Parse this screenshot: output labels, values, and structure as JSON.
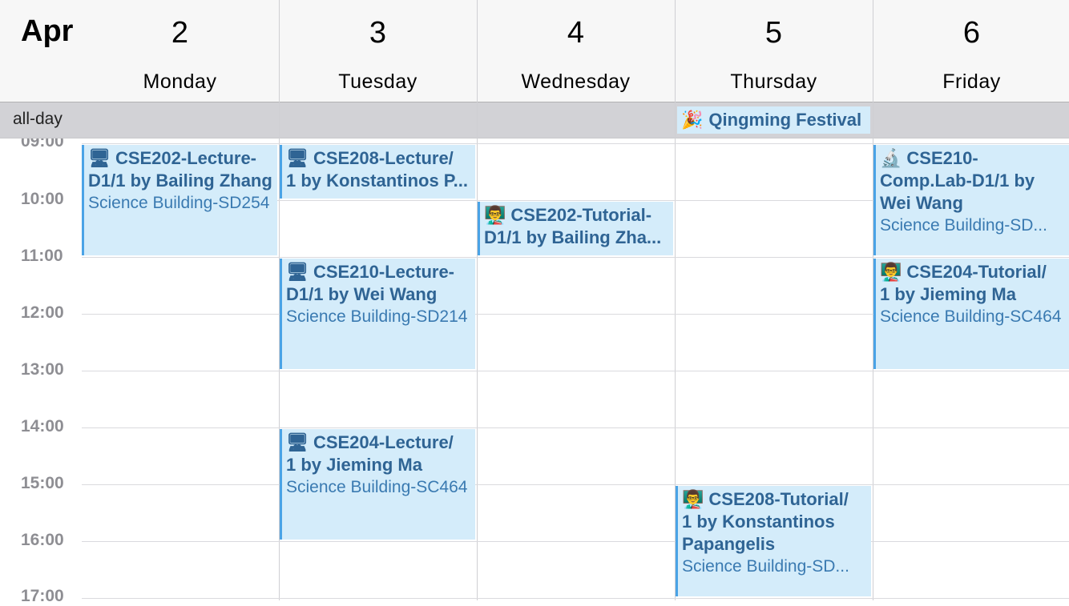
{
  "header": {
    "month": "Apr",
    "days": [
      {
        "num": "2",
        "name": "Monday"
      },
      {
        "num": "3",
        "name": "Tuesday"
      },
      {
        "num": "4",
        "name": "Wednesday"
      },
      {
        "num": "5",
        "name": "Thursday"
      },
      {
        "num": "6",
        "name": "Friday"
      }
    ]
  },
  "all_day": {
    "label": "all-day",
    "event": {
      "icon": "🎉",
      "icon_name": "party-popper-icon",
      "title": "Qingming Festival"
    }
  },
  "times": [
    "09:00",
    "10:00",
    "11:00",
    "12:00",
    "13:00",
    "14:00",
    "15:00",
    "16:00",
    "17:00"
  ],
  "events": [
    {
      "icon": "🖥",
      "icon_name": "desktop-computer-icon",
      "line1": "CSE202-Lecture-",
      "line2": "D1/1 by Bailing Zhang",
      "location": "Science Building-SD254"
    },
    {
      "icon": "🖥",
      "icon_name": "desktop-computer-icon",
      "line1": "CSE208-Lecture/",
      "line2": "1 by Konstantinos P...",
      "location": ""
    },
    {
      "icon": "🖥",
      "icon_name": "desktop-computer-icon",
      "line1": "CSE210-Lecture-",
      "line2": "D1/1 by Wei Wang",
      "location": "Science Building-SD214"
    },
    {
      "icon": "🖥",
      "icon_name": "desktop-computer-icon",
      "line1": "CSE204-Lecture/",
      "line2": "1 by Jieming Ma",
      "location": "Science Building-SC464"
    },
    {
      "icon": "👨‍🏫",
      "icon_name": "teacher-icon",
      "line1": "CSE202-Tutorial-",
      "line2": "D1/1 by Bailing Zha...",
      "location": ""
    },
    {
      "icon": "👨‍🏫",
      "icon_name": "teacher-icon",
      "line1": "CSE208-Tutorial/",
      "line2": "1 by Konstantinos",
      "line3": "Papangelis",
      "location": "Science Building-SD..."
    },
    {
      "icon": "🔬",
      "icon_name": "microscope-icon",
      "line1": "CSE210-",
      "line2": "Comp.Lab-D1/1 by",
      "line3": "Wei Wang",
      "location": "Science Building-SD..."
    },
    {
      "icon": "👨‍🏫",
      "icon_name": "teacher-icon",
      "line1": "CSE204-Tutorial/",
      "line2": "1 by Jieming Ma",
      "location": "Science Building-SC464"
    }
  ],
  "colors": {
    "event_bg": "#d4ecfa",
    "event_bar": "#4aa3e6",
    "event_title": "#2f6494",
    "allday_bg": "#d2d2d6"
  }
}
